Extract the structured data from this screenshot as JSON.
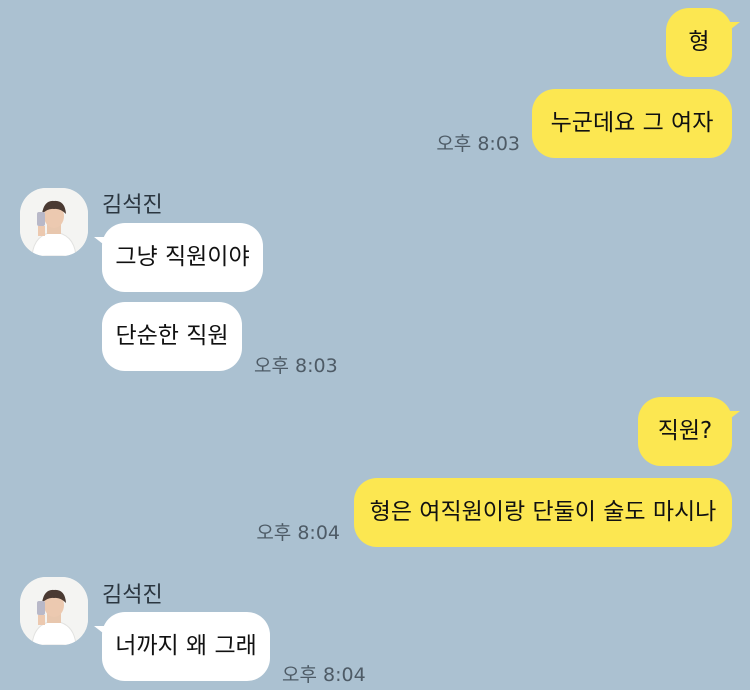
{
  "messages": [
    {
      "side": "out",
      "text": "형"
    },
    {
      "side": "out",
      "text": "누군데요 그 여자",
      "time": "오후 8:03"
    },
    {
      "side": "in",
      "sender": "김석진",
      "text": "그냥 직원이야"
    },
    {
      "side": "in",
      "text": "단순한 직원",
      "time": "오후 8:03"
    },
    {
      "side": "out",
      "text": "직원?"
    },
    {
      "side": "out",
      "text": "형은 여직원이랑 단둘이 술도 마시나",
      "time": "오후 8:04"
    },
    {
      "side": "in",
      "sender": "김석진",
      "text": "너까지 왜 그래",
      "time": "오후 8:04"
    }
  ],
  "colors": {
    "background": "#abc1d1",
    "outgoing_bubble": "#fce751",
    "incoming_bubble": "#ffffff"
  },
  "icons": {
    "avatar": "profile-photo"
  }
}
